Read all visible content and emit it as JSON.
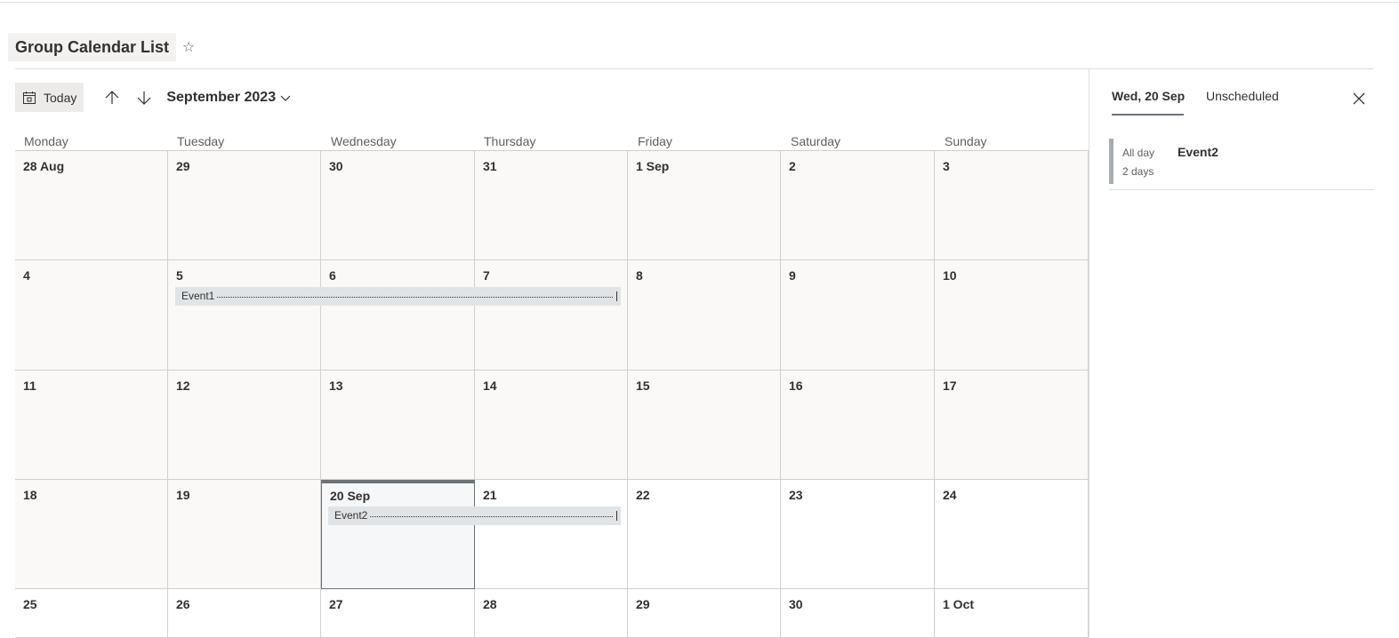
{
  "page": {
    "title": "Group Calendar List",
    "favorite_icon": "star-outline-icon"
  },
  "toolbar": {
    "today_label": "Today",
    "today_icon": "calendar-today-icon",
    "prev_icon": "arrow-up-icon",
    "next_icon": "arrow-down-icon",
    "month_label": "September 2023",
    "month_dropdown_icon": "chevron-down-icon"
  },
  "calendar": {
    "weekdays": [
      "Monday",
      "Tuesday",
      "Wednesday",
      "Thursday",
      "Friday",
      "Saturday",
      "Sunday"
    ],
    "weeks": [
      [
        "28 Aug",
        "29",
        "30",
        "31",
        "1 Sep",
        "2",
        "3"
      ],
      [
        "4",
        "5",
        "6",
        "7",
        "8",
        "9",
        "10"
      ],
      [
        "11",
        "12",
        "13",
        "14",
        "15",
        "16",
        "17"
      ],
      [
        "18",
        "19",
        "20 Sep",
        "21",
        "22",
        "23",
        "24"
      ],
      [
        "25",
        "26",
        "27",
        "28",
        "29",
        "30",
        "1 Oct"
      ]
    ],
    "today": "20 Sep",
    "events": [
      {
        "title": "Event1",
        "start": "5",
        "end": "7"
      },
      {
        "title": "Event2",
        "start": "20 Sep",
        "end": "21"
      }
    ]
  },
  "panel": {
    "tabs": [
      "Wed, 20 Sep",
      "Unscheduled"
    ],
    "active_tab": "Wed, 20 Sep",
    "close_icon": "close-icon",
    "events": [
      {
        "time": "All day",
        "duration": "2 days",
        "title": "Event2"
      }
    ]
  },
  "colors": {
    "accent": "#6c7378",
    "event_fill": "#e1e4e6",
    "event_stripe": "#a6aeb4",
    "past_day_bg": "#faf9f8"
  }
}
